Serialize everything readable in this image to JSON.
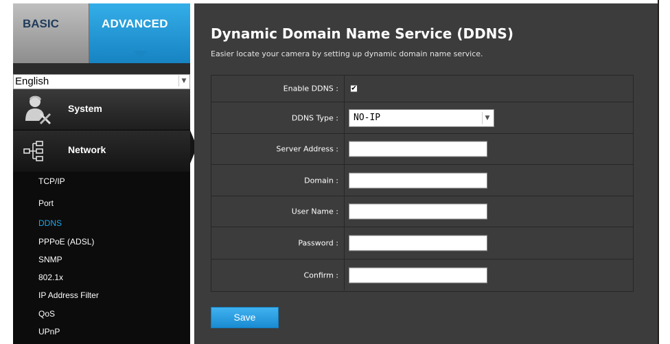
{
  "tabs": {
    "basic": "BASIC",
    "advanced": "ADVANCED"
  },
  "language": {
    "selected": "English"
  },
  "menu": {
    "system": "System",
    "network": "Network",
    "network_items": [
      {
        "label": "TCP/IP",
        "active": false
      },
      {
        "label": "Port",
        "active": false
      },
      {
        "label": "DDNS",
        "active": true
      },
      {
        "label": "PPPoE (ADSL)",
        "active": false
      },
      {
        "label": "SNMP",
        "active": false
      },
      {
        "label": "802.1x",
        "active": false
      },
      {
        "label": "IP Address Filter",
        "active": false
      },
      {
        "label": "QoS",
        "active": false
      },
      {
        "label": "UPnP",
        "active": false
      }
    ]
  },
  "page": {
    "title": "Dynamic Domain Name Service (DDNS)",
    "subtitle": "Easier locate your camera by setting up dynamic domain name service."
  },
  "form": {
    "enable_label": "Enable DDNS :",
    "enable_checked": true,
    "enable_check_glyph": "✔",
    "type_label": "DDNS Type :",
    "type_value": "NO-IP",
    "server_label": "Server Address :",
    "server_value": "",
    "domain_label": "Domain :",
    "domain_value": "",
    "user_label": "User Name :",
    "user_value": "",
    "password_label": "Password :",
    "password_value": "",
    "confirm_label": "Confirm :",
    "confirm_value": ""
  },
  "buttons": {
    "save": "Save"
  },
  "colors": {
    "accent": "#1ea7ec",
    "panel": "#3c3c3c",
    "sidebar": "#0c0c0c"
  },
  "icons": {
    "dropdown": "chevron-down-icon",
    "system": "user-tools-icon",
    "network": "network-tree-icon"
  }
}
